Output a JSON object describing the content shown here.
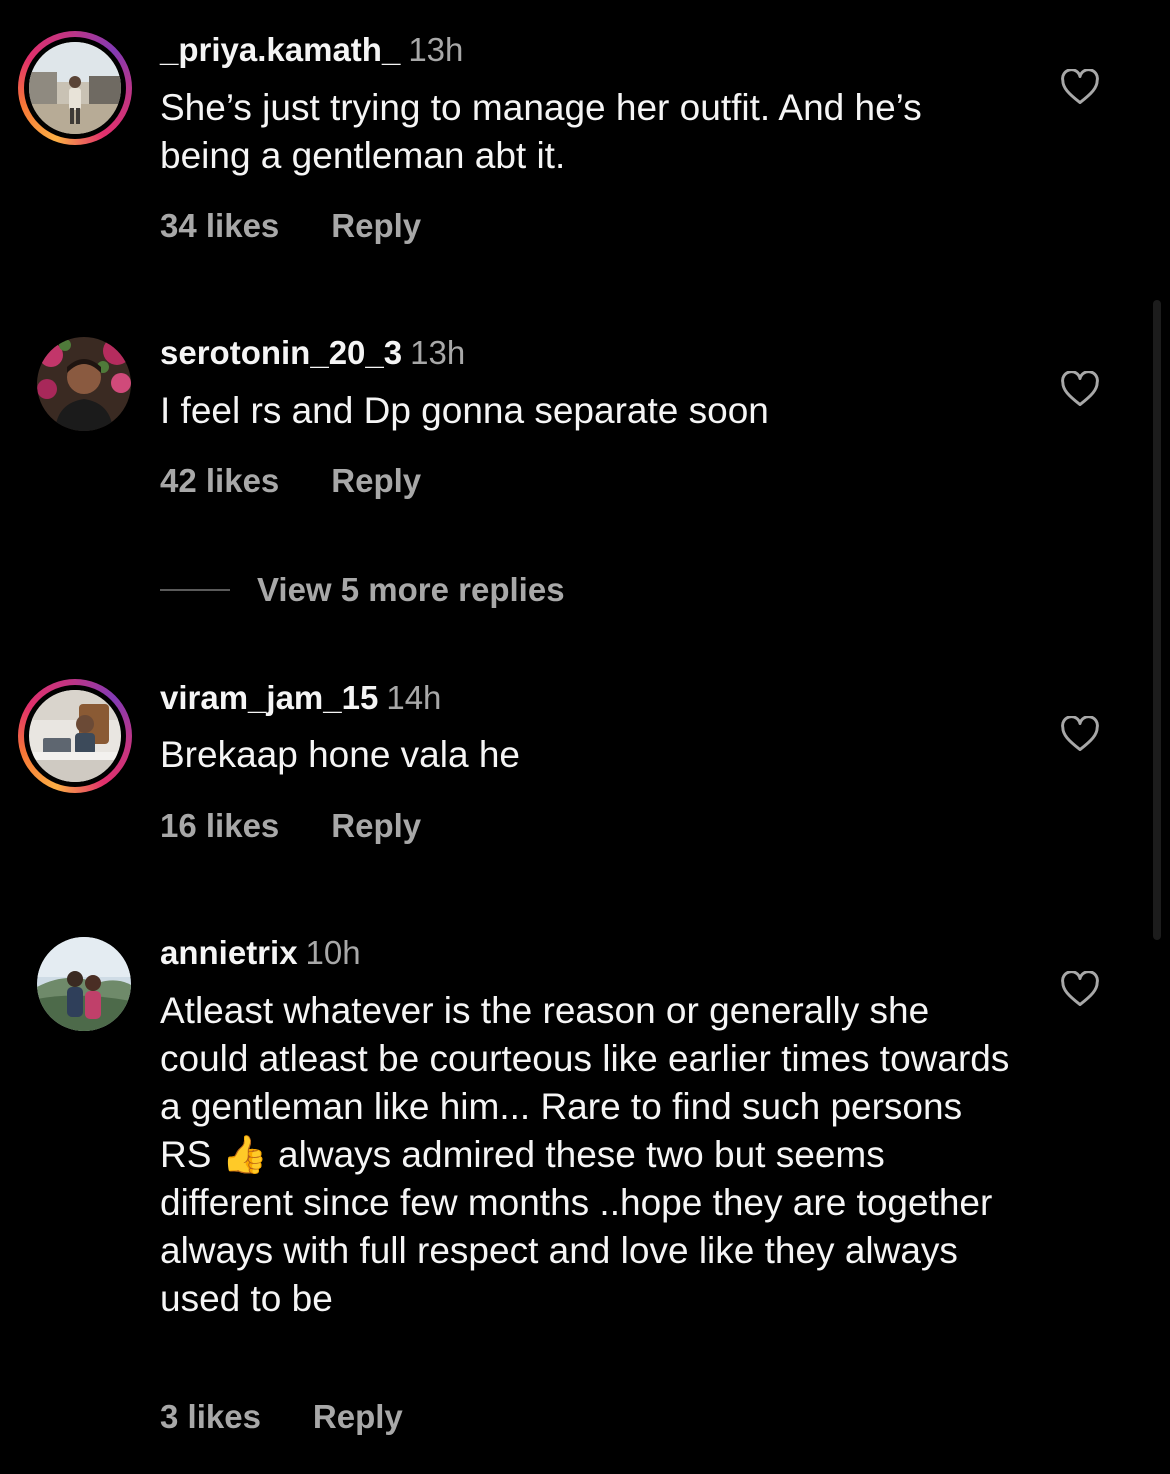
{
  "comments": [
    {
      "username": "_priya.kamath_",
      "time": "13h",
      "text": "She’s just trying to manage her outfit. And he’s being a gentleman abt it.",
      "likes": "34 likes",
      "reply_label": "Reply",
      "avatar_ring": true,
      "avatar_icon": "avatar-photo-street"
    },
    {
      "username": "serotonin_20_3",
      "time": "13h",
      "text": "I feel rs and Dp gonna separate soon",
      "likes": "42 likes",
      "reply_label": "Reply",
      "avatar_ring": false,
      "avatar_icon": "avatar-photo-flowers"
    },
    {
      "username": "viram_jam_15",
      "time": "14h",
      "text": "Brekaap hone vala he",
      "likes": "16 likes",
      "reply_label": "Reply",
      "avatar_ring": true,
      "avatar_icon": "avatar-photo-office"
    },
    {
      "username": "annietrix",
      "time": "10h",
      "text_before_emoji": "Atleast whatever is the reason or generally she could atleast be courteous like earlier times towards a gentleman like him... Rare to find such persons RS ",
      "emoji": "👍",
      "text_after_emoji": " always admired these two but seems different since few months ..hope they are together always with full respect and love like they always used to be",
      "likes": "3 likes",
      "reply_label": "Reply",
      "avatar_ring": false,
      "avatar_icon": "avatar-photo-couple"
    }
  ],
  "view_more_replies": "View 5 more replies",
  "icons": {
    "like": "heart-outline-icon"
  },
  "colors": {
    "background": "#000000",
    "primary_text": "#f5f5f5",
    "secondary_text": "#a8a8a8",
    "story_ring_start": "#fcaf45",
    "story_ring_end": "#c13584"
  }
}
